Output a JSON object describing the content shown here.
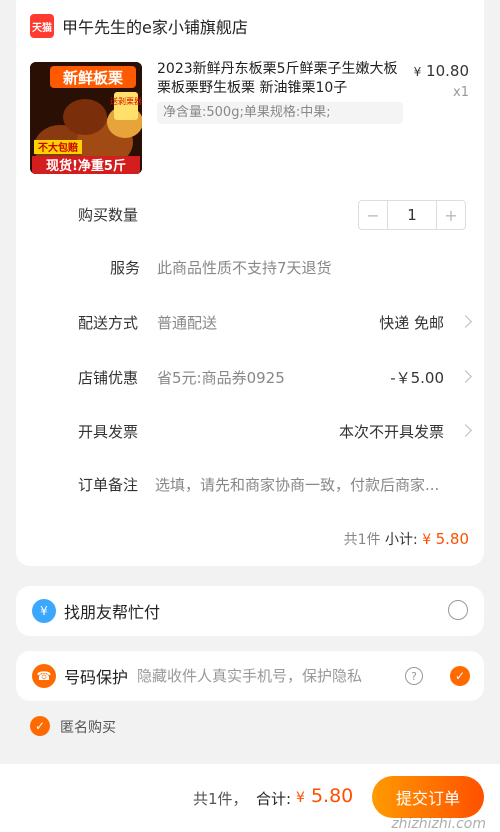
{
  "shop": {
    "badge": "天猫",
    "name": "甲午先生的e家小铺旗舰店"
  },
  "product": {
    "title": "2023新鲜丹东板栗5斤鲜栗子生嫩大板栗板栗野生板栗 新油锥栗10子",
    "spec": "净含量:500g;单果规格:中果;",
    "price_currency": "¥",
    "price": "10.80",
    "quantity_label": "x1",
    "image_texts": [
      "新鲜板栗",
      "送剥栗器",
      "不大包赔",
      "现货!净重5斤"
    ]
  },
  "rows": {
    "quantity": {
      "label": "购买数量",
      "minus": "−",
      "value": "1",
      "plus": "+"
    },
    "service": {
      "label": "服务",
      "value": "此商品性质不支持7天退货"
    },
    "delivery": {
      "label": "配送方式",
      "value": "普通配送",
      "right": "快递 免邮"
    },
    "coupon": {
      "label": "店铺优惠",
      "value": "省5元:商品券0925",
      "right": "-￥5.00"
    },
    "invoice": {
      "label": "开具发票",
      "right": "本次不开具发票"
    },
    "remark": {
      "label": "订单备注",
      "placeholder": "选填，请先和商家协商一致，付款后商家..."
    }
  },
  "subtotal": {
    "count": "共1件",
    "label": "小计:",
    "currency": "¥",
    "amount": "5.80"
  },
  "friend_pay": {
    "label": "找朋友帮忙付"
  },
  "privacy": {
    "label": "号码保护",
    "hint": "隐藏收件人真实手机号，保护隐私",
    "help": "?"
  },
  "anonymous": {
    "label": "匿名购买"
  },
  "footer": {
    "count": "共1件，",
    "total_label": "合计:",
    "currency": "¥",
    "amount": "5.80",
    "submit": "提交订单",
    "watermark": "zhizhizhi.com"
  },
  "colors": {
    "accent": "#ff5000",
    "tmall_red": "#ff3b2f",
    "bg": "#f2f2f2"
  }
}
